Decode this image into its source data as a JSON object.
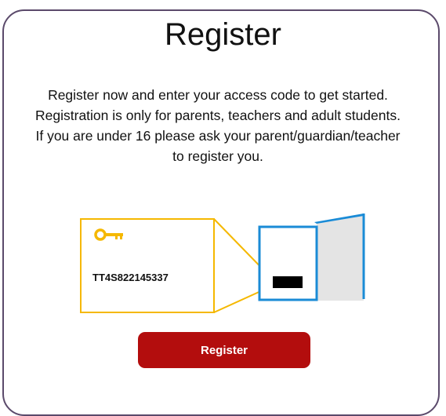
{
  "title": "Register",
  "description": "Register now and enter your access code to get started. Registration is only for parents, teachers and adult students. If you are under 16 please ask your parent/guardian/teacher to register you.",
  "access_code_example": "TT4S822145337",
  "icons": {
    "key": "key-icon",
    "book": "book-icon"
  },
  "colors": {
    "accent_yellow": "#f5b800",
    "book_blue": "#1a8bd6",
    "button_red": "#b30d0d",
    "card_border": "#5b4a6b"
  },
  "register_button_label": "Register"
}
